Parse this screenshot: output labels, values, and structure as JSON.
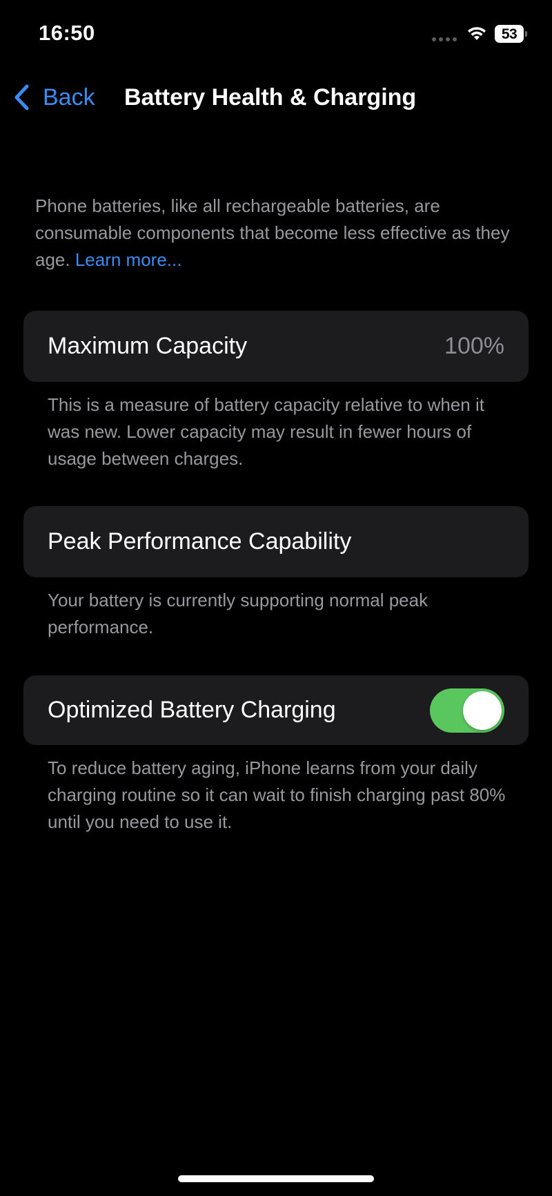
{
  "status_bar": {
    "time": "16:50",
    "battery_level": "53",
    "wifi_icon": "wifi-icon",
    "signal_icon": "cellular-signal-icon"
  },
  "nav": {
    "back_label": "Back",
    "title": "Battery Health & Charging"
  },
  "intro": {
    "text": "Phone batteries, like all rechargeable batteries, are consumable components that become less effective as they age. ",
    "link": "Learn more..."
  },
  "maximum_capacity": {
    "label": "Maximum Capacity",
    "value": "100%",
    "note": "This is a measure of battery capacity relative to when it was new. Lower capacity may result in fewer hours of usage between charges."
  },
  "peak_performance": {
    "label": "Peak Performance Capability",
    "note": "Your battery is currently supporting normal peak performance."
  },
  "optimized_charging": {
    "label": "Optimized Battery Charging",
    "enabled": true,
    "note": "To reduce battery aging, iPhone learns from your daily charging routine so it can wait to finish charging past 80% until you need to use it."
  },
  "colors": {
    "background": "#000000",
    "card": "#1c1c1e",
    "accent_blue": "#3a8cf5",
    "toggle_on": "#5ac75e",
    "secondary_text": "#98989e"
  }
}
